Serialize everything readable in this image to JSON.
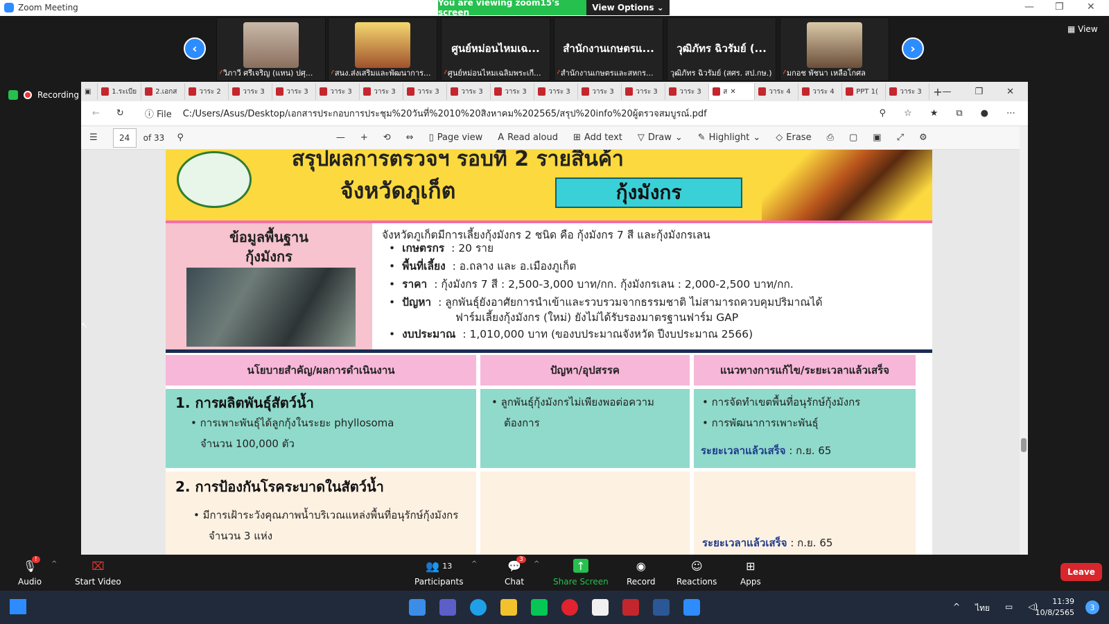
{
  "titlebar": {
    "app_title": "Zoom Meeting",
    "share_banner": "You are viewing zoom15's screen",
    "view_options": "View Options"
  },
  "video_strip": {
    "view_label": "View",
    "tiles": [
      {
        "caption": "วิภาวี ศรีเจริญ (แหน) ปศุ...",
        "big_name": ""
      },
      {
        "caption": "สนง.ส่งเสริมและพัฒนาการ...",
        "big_name": ""
      },
      {
        "caption": "ศูนย์หม่อนไหมเฉลิมพระเกี...",
        "big_name": "ศูนย์หม่อนไหมเฉ..."
      },
      {
        "caption": "สำนักงานเกษตรและสหกร...",
        "big_name": "สำนักงานเกษตรแ..."
      },
      {
        "caption": "วุฒิภัทร ฉิวรัมย์ (สศร. สป.กษ.)",
        "big_name": "วุฒิภัทร ฉิวรัมย์ (..."
      },
      {
        "caption": "มกอช พัชนา เหลือโกศล",
        "big_name": ""
      }
    ]
  },
  "recording": {
    "label": "Recording"
  },
  "browser": {
    "tabs": [
      "1.ระเบีย",
      "2.เอกส",
      "วาระ 2",
      "วาระ 3",
      "วาระ 3",
      "วาระ 3",
      "วาระ 3",
      "วาระ 3",
      "วาระ 3",
      "วาระ 3",
      "วาระ 3",
      "วาระ 3",
      "วาระ 3",
      "วาระ 3",
      "ส",
      "วาระ 4",
      "วาระ 4",
      "PPT 1(",
      "วาระ 3"
    ],
    "address_prefix": "File",
    "url": "C:/Users/Asus/Desktop/เอกสารประกอบการประชุม%20วันที่%2010%20สิงหาคม%202565/สรุป%20info%20ผู้ตรวจสมบูรณ์.pdf",
    "toolbar": {
      "page": "24",
      "of_pages": "of 33",
      "page_view": "Page view",
      "read_aloud": "Read aloud",
      "add_text": "Add text",
      "draw": "Draw",
      "highlight": "Highlight",
      "erase": "Erase"
    }
  },
  "slide": {
    "title_line1": "สรุปผลการตรวจฯ รอบที่ 2 รายสินค้า",
    "title_line2": "จังหวัดภูเก็ต",
    "ribbon": "กุ้งมังกร",
    "info_title_1": "ข้อมูลพื้นฐาน",
    "info_title_2": "กุ้งมังกร",
    "intro": "จังหวัดภูเก็ตมีการเลี้ยงกุ้งมังกร 2 ชนิด คือ กุ้งมังกร 7 สี และกุ้งมังกรเลน",
    "bullets": [
      {
        "k": "เกษตรกร",
        "v": ": 20 ราย"
      },
      {
        "k": "พื้นที่เลี้ยง",
        "v": ": อ.ถลาง และ อ.เมืองภูเก็ต"
      },
      {
        "k": "ราคา",
        "v": ": กุ้งมังกร 7 สี : 2,500-3,000 บาท/กก.  กุ้งมังกรเลน : 2,000-2,500 บาท/กก."
      },
      {
        "k": "ปัญหา",
        "v": ": ลูกพันธุ์ยังอาศัยการนำเข้าและรวบรวมจากธรรมชาติ ไม่สามารถควบคุมปริมาณได้"
      },
      {
        "k": "",
        "v": "ฟาร์มเลี้ยงกุ้งมังกร (ใหม่) ยังไม่ได้รับรองมาตรฐานฟาร์ม GAP"
      },
      {
        "k": "งบประมาณ",
        "v": ": 1,010,000 บาท (ของบประมาณจังหวัด ปีงบประมาณ 2566)"
      }
    ],
    "col_heads": [
      "นโยบายสำคัญ/ผลการดำเนินงาน",
      "ปัญหา/อุปสรรค",
      "แนวทางการแก้ไข/ระยะเวลาแล้วเสร็จ"
    ],
    "sec1": {
      "title": "1. การผลิตพันธุ์สัตว์น้ำ",
      "l1": "•  การเพาะพันธุ์ได้ลูกกุ้งในระยะ phyllosoma",
      "l2": "จำนวน 100,000 ตัว",
      "p1": "•  ลูกพันธุ์กุ้งมังกรไม่เพียงพอต่อความ",
      "p2": "ต้องการ",
      "s1": "•  การจัดทำเขตพื้นที่อนุรักษ์กุ้งมังกร",
      "s2": "•  การพัฒนาการเพาะพันธุ์",
      "dl_label": "ระยะเวลาแล้วเสร็จ",
      "dl_val": ": ก.ย. 65"
    },
    "sec2": {
      "title": "2. การป้องกันโรคระบาดในสัตว์น้ำ",
      "l1": "•  มีการเฝ้าระวังคุณภาพน้ำบริเวณแหล่งพื้นที่อนุรักษ์กุ้งมังกร",
      "l2": "จำนวน  3 แห่ง",
      "dl_label": "ระยะเวลาแล้วเสร็จ",
      "dl_val": ": ก.ย. 65"
    }
  },
  "controls": {
    "audio": "Audio",
    "start_video": "Start Video",
    "participants": "Participants",
    "participants_count": "13",
    "chat": "Chat",
    "chat_badge": "3",
    "share": "Share Screen",
    "record": "Record",
    "reactions": "Reactions",
    "apps": "Apps",
    "leave": "Leave",
    "audio_badge": "!"
  },
  "taskbar": {
    "lang": "ไทย",
    "time": "11:39",
    "date": "10/8/2565",
    "notif": "3"
  }
}
